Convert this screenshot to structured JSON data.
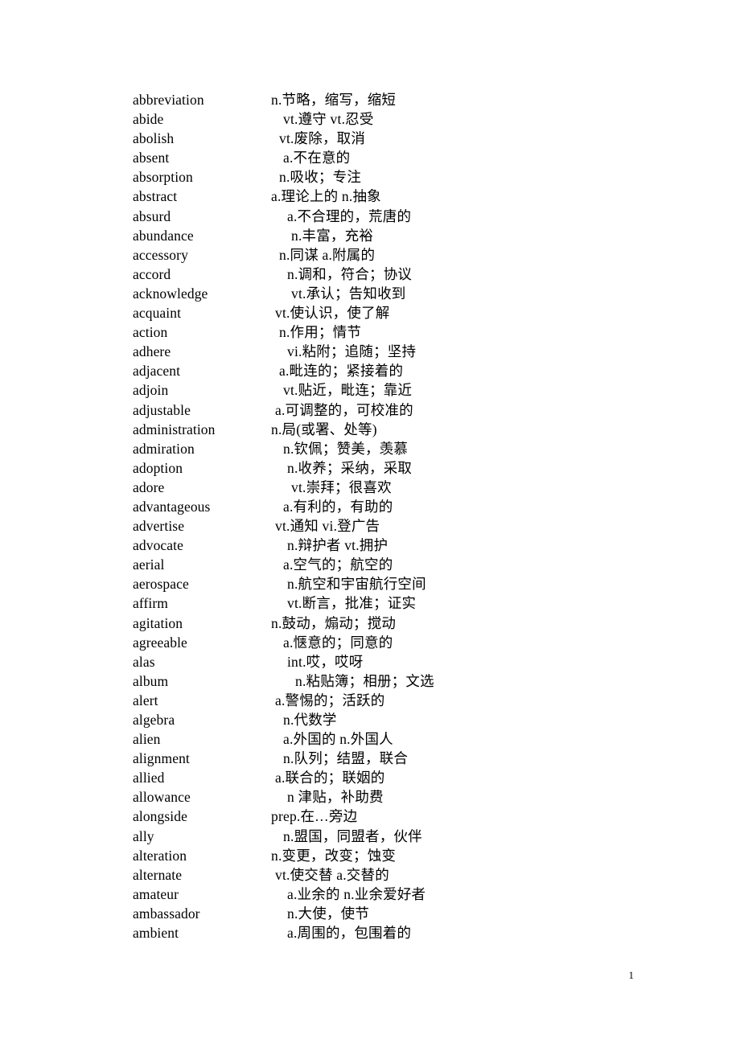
{
  "document": {
    "page_number": "1",
    "entries": [
      {
        "term": "abbreviation",
        "definition": "n.节略，缩写，缩短",
        "indent": 0
      },
      {
        "term": "abide",
        "definition": "vt.遵守  vt.忍受",
        "indent": 3
      },
      {
        "term": "abolish",
        "definition": "vt.废除，取消",
        "indent": 2
      },
      {
        "term": "absent",
        "definition": "a.不在意的",
        "indent": 3
      },
      {
        "term": "absorption",
        "definition": "n.吸收；专注",
        "indent": 2
      },
      {
        "term": "abstract",
        "definition": "a.理论上的  n.抽象",
        "indent": 0
      },
      {
        "term": "absurd",
        "definition": "a.不合理的，荒唐的",
        "indent": 4
      },
      {
        "term": "abundance",
        "definition": "n.丰富，充裕",
        "indent": 5
      },
      {
        "term": "accessory",
        "definition": "n.同谋  a.附属的",
        "indent": 2
      },
      {
        "term": "accord",
        "definition": "n.调和，符合；协议",
        "indent": 4
      },
      {
        "term": "acknowledge",
        "definition": "vt.承认；告知收到",
        "indent": 5
      },
      {
        "term": "acquaint",
        "definition": "vt.使认识，使了解",
        "indent": 1
      },
      {
        "term": "action",
        "definition": "n.作用；情节",
        "indent": 2
      },
      {
        "term": "adhere",
        "definition": "vi.粘附；追随；坚持",
        "indent": 4
      },
      {
        "term": "adjacent",
        "definition": "a.毗连的；紧接着的",
        "indent": 2
      },
      {
        "term": "adjoin",
        "definition": "vt.贴近，毗连；靠近",
        "indent": 3
      },
      {
        "term": "adjustable",
        "definition": "a.可调整的，可校准的",
        "indent": 1
      },
      {
        "term": "administration",
        "definition": "n.局(或署、处等)",
        "indent": 0
      },
      {
        "term": "admiration",
        "definition": "n.钦佩；赞美，羡慕",
        "indent": 3
      },
      {
        "term": "adoption",
        "definition": "n.收养；采纳，采取",
        "indent": 4
      },
      {
        "term": "adore",
        "definition": "vt.崇拜；很喜欢",
        "indent": 5
      },
      {
        "term": "advantageous",
        "definition": "a.有利的，有助的",
        "indent": 3
      },
      {
        "term": "advertise",
        "definition": "vt.通知  vi.登广告",
        "indent": 1
      },
      {
        "term": "advocate",
        "definition": "n.辩护者  vt.拥护",
        "indent": 4
      },
      {
        "term": "aerial",
        "definition": "a.空气的；航空的",
        "indent": 3
      },
      {
        "term": "aerospace",
        "definition": "n.航空和宇宙航行空间",
        "indent": 4
      },
      {
        "term": "affirm",
        "definition": "vt.断言，批准；证实",
        "indent": 4
      },
      {
        "term": "agitation",
        "definition": "n.鼓动，煽动；搅动",
        "indent": 0
      },
      {
        "term": "agreeable",
        "definition": "a.惬意的；同意的",
        "indent": 3
      },
      {
        "term": "alas",
        "definition": "int.哎，哎呀",
        "indent": 4
      },
      {
        "term": "album",
        "definition": "n.粘贴簿；相册；文选",
        "indent": 6
      },
      {
        "term": "alert",
        "definition": "a.警惕的；活跃的",
        "indent": 1
      },
      {
        "term": "algebra",
        "definition": "n.代数学",
        "indent": 3
      },
      {
        "term": "alien",
        "definition": "a.外国的  n.外国人",
        "indent": 3
      },
      {
        "term": "alignment",
        "definition": "n.队列；结盟，联合",
        "indent": 3
      },
      {
        "term": "allied",
        "definition": "a.联合的；联姻的",
        "indent": 1
      },
      {
        "term": "allowance",
        "definition": "n 津贴，补助费",
        "indent": 4
      },
      {
        "term": "alongside",
        "definition": "prep.在…旁边",
        "indent": 0
      },
      {
        "term": "ally",
        "definition": "n.盟国，同盟者，伙伴",
        "indent": 3
      },
      {
        "term": "alteration",
        "definition": "n.变更，改变；蚀变",
        "indent": 0
      },
      {
        "term": "alternate",
        "definition": "vt.使交替  a.交替的",
        "indent": 1
      },
      {
        "term": "amateur",
        "definition": "a.业余的 n.业余爱好者",
        "indent": 4
      },
      {
        "term": "ambassador",
        "definition": "n.大使，使节",
        "indent": 4
      },
      {
        "term": "ambient",
        "definition": "a.周围的，包围着的",
        "indent": 4
      }
    ]
  }
}
